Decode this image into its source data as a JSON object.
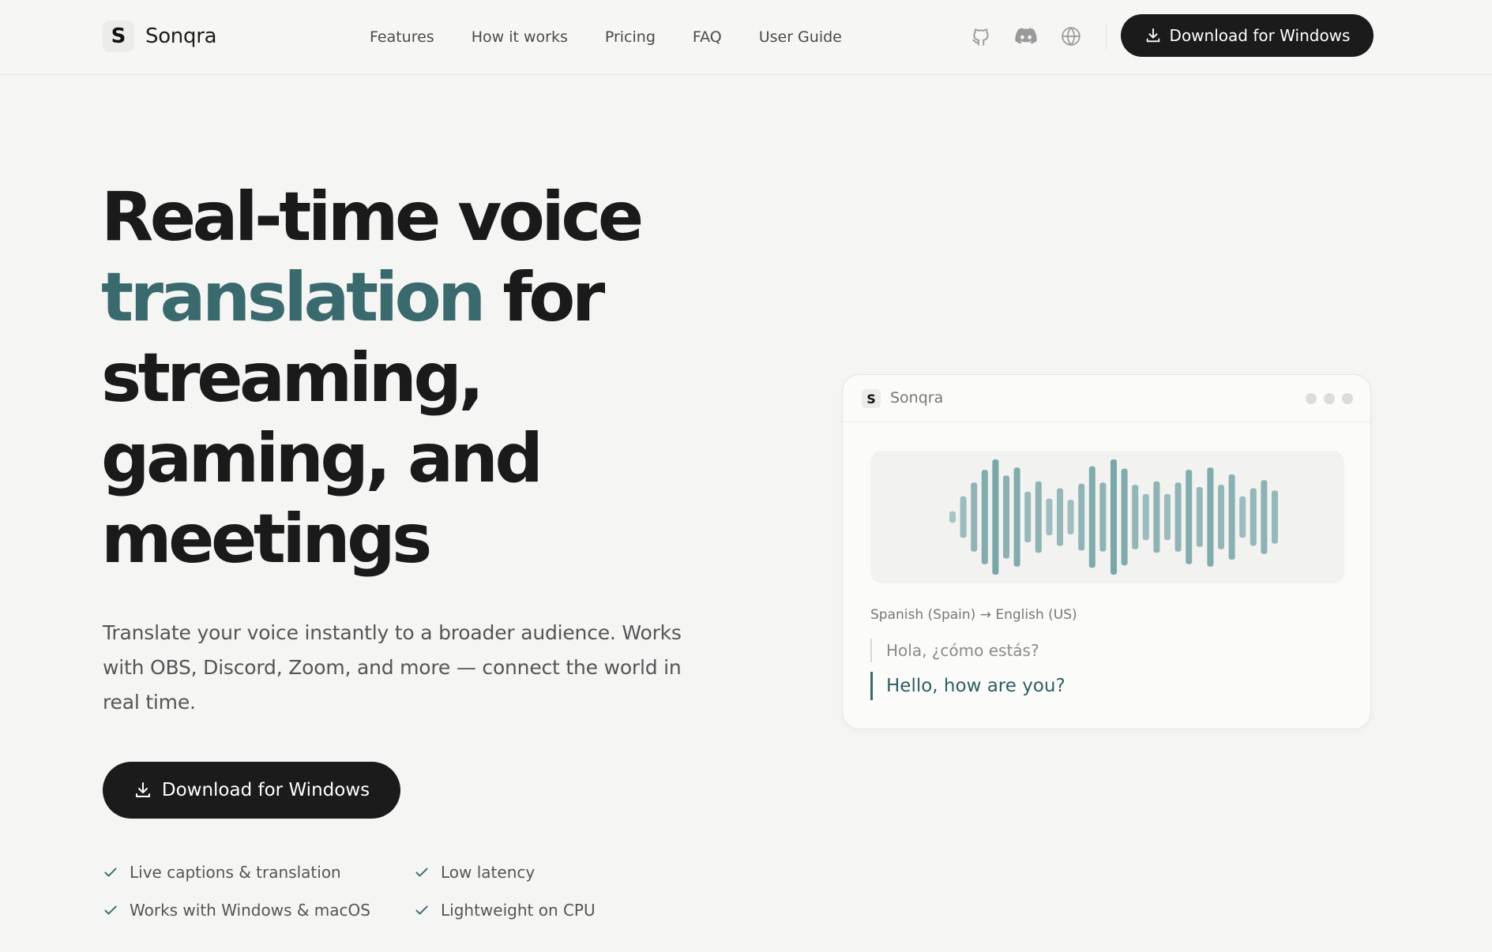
{
  "brand": {
    "mark": "S",
    "name": "Sonqra"
  },
  "nav": {
    "items": [
      {
        "label": "Features"
      },
      {
        "label": "How it works"
      },
      {
        "label": "Pricing"
      },
      {
        "label": "FAQ"
      },
      {
        "label": "User Guide"
      }
    ]
  },
  "header_icons": [
    "github-icon",
    "discord-icon",
    "globe-icon"
  ],
  "header_cta": {
    "label": "Download for Windows",
    "icon": "download-icon"
  },
  "hero": {
    "title_line1": "Real-time voice",
    "title_accent": "translation",
    "title_after_accent": " for",
    "title_line3": "streaming,",
    "title_line4": "gaming, and",
    "title_line5": "meetings",
    "subtitle": "Translate your voice instantly to a broader audience. Works with OBS, Discord, Zoom, and more — connect the world in real time.",
    "cta": {
      "label": "Download for Windows",
      "icon": "download-icon"
    },
    "features": [
      {
        "label": "Live captions & translation"
      },
      {
        "label": "Low latency"
      },
      {
        "label": "Works with Windows & macOS"
      },
      {
        "label": "Lightweight on CPU"
      }
    ]
  },
  "preview": {
    "logo": "S",
    "title": "Sonqra",
    "language_pair": "Spanish (Spain) → English (US)",
    "original_text": "Hola, ¿cómo estás?",
    "translated_text": "Hello, how are you?",
    "waveform_levels": [
      0.1,
      0.36,
      0.6,
      0.82,
      1.0,
      0.72,
      0.86,
      0.44,
      0.62,
      0.32,
      0.5,
      0.3,
      0.58,
      0.88,
      0.6,
      1.0,
      0.84,
      0.56,
      0.4,
      0.62,
      0.4,
      0.6,
      0.82,
      0.52,
      0.86,
      0.56,
      0.74,
      0.36,
      0.5,
      0.64,
      0.46
    ]
  },
  "colors": {
    "accent": "#3a6a6e",
    "waveform": "#7aa6a8",
    "button": "#1b1b1b",
    "background": "#f5f5f4"
  }
}
